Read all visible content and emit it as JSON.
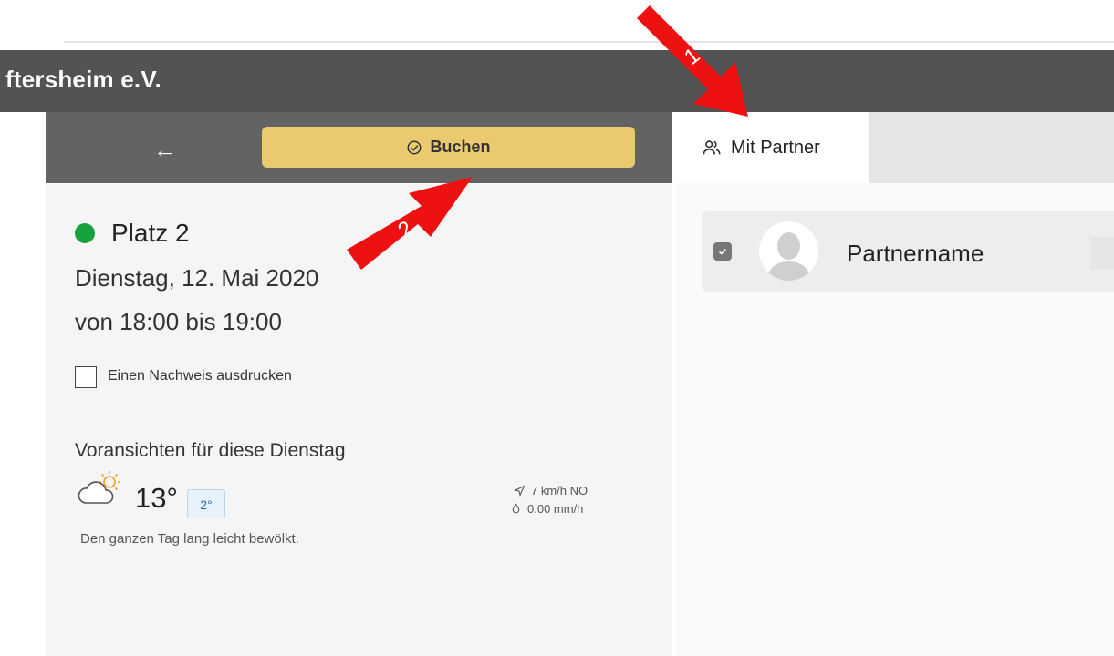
{
  "header": {
    "club_title": "ftersheim e.V."
  },
  "toolbar": {
    "back_icon": "arrow-left-icon",
    "book_label": "Buchen",
    "book_icon": "check-circle-icon"
  },
  "booking": {
    "court": "Platz 2",
    "date": "Dienstag, 12. Mai 2020",
    "time": "von 18:00 bis 19:00",
    "print_label": "Einen Nachweis ausdrucken",
    "print_checked": false
  },
  "forecast": {
    "title": "Voransichten für diese Dienstag",
    "temp_max": "13°",
    "temp_min": "2°",
    "wind": "7 km/h NO",
    "precip": "0.00 mm/h",
    "description": "Den ganzen Tag lang leicht bewölkt.",
    "icon": "cloud-sun-icon"
  },
  "partner_tab": {
    "label": "Mit Partner",
    "icon": "users-icon"
  },
  "partners": [
    {
      "name": "Partnername",
      "checked": true
    }
  ],
  "annotations": [
    {
      "label": "1"
    },
    {
      "label": "2"
    }
  ],
  "colors": {
    "book_button": "#ebc971",
    "status_dot": "#17a23e",
    "arrow_red": "#ee1111",
    "banner": "#535353"
  }
}
